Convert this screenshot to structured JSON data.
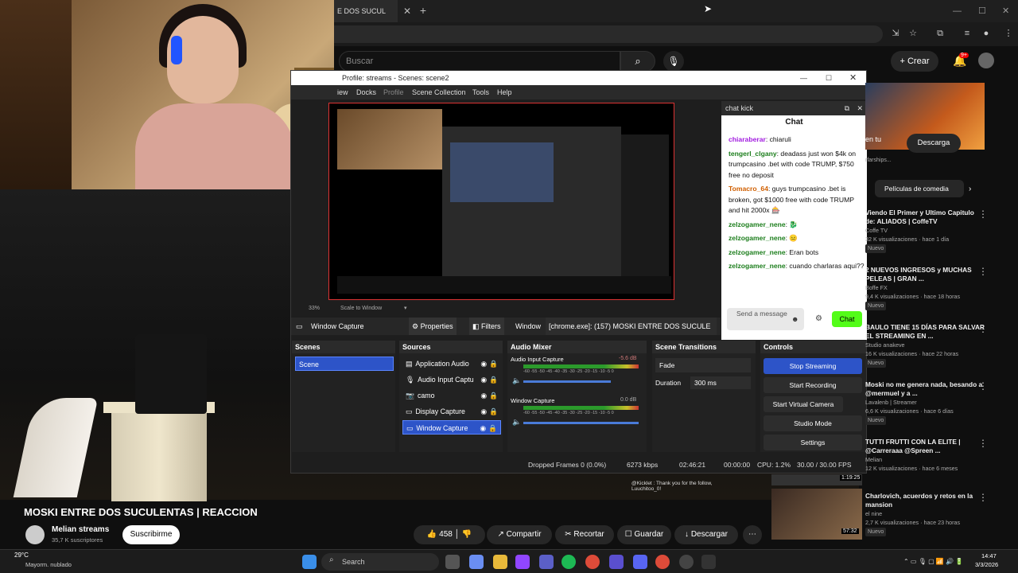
{
  "browser": {
    "tab_title": "E DOS SUCUL",
    "tab_close": "✕",
    "new_tab": "+",
    "win_min": "—",
    "win_max": "☐",
    "win_close": "✕"
  },
  "yt": {
    "search_placeholder": "Buscar",
    "create": "Crear",
    "notif_count": "9+",
    "video_title": "MOSKI ENTRE DOS SUCULENTAS | REACCION",
    "channel": "Melian streams",
    "subs": "35,7 K suscriptores",
    "subscribe": "Suscribirme",
    "likes": "458",
    "share": "Compartir",
    "clip": "Recortar",
    "save": "Guardar",
    "download": "Descargar"
  },
  "obs": {
    "window_title": "Profile: streams - Scenes: scene2",
    "menu": [
      "iew",
      "Docks",
      "Profile",
      "Scene Collection",
      "Tools",
      "Help"
    ],
    "zoom": "33%",
    "scale": "Scale to Window",
    "source_bar": {
      "name": "Window Capture",
      "properties": "Properties",
      "filters": "Filters",
      "window_label": "Window",
      "window_value": "[chrome.exe]: (157) MOSKI ENTRE DOS SUCULE"
    },
    "scenes": {
      "title": "Scenes",
      "items": [
        "Scene"
      ]
    },
    "sources": {
      "title": "Sources",
      "items": [
        "Application Audio",
        "Audio Input Captu",
        "camo",
        "Display Capture",
        "Window Capture"
      ]
    },
    "mixer": {
      "title": "Audio Mixer",
      "ch1": "Audio Input Capture",
      "ch1_db": "-5.6 dB",
      "ch2": "Window Capture",
      "ch2_db": "0.0 dB",
      "scale": "-60 -55 -50 -45 -40 -35 -30 -25 -20 -15 -10 -5 0"
    },
    "transitions": {
      "title": "Scene Transitions",
      "type": "Fade",
      "duration_label": "Duration",
      "duration": "300 ms"
    },
    "controls": {
      "title": "Controls",
      "stop_streaming": "Stop Streaming",
      "start_recording": "Start Recording",
      "virtual_cam": "Start Virtual Camera",
      "studio": "Studio Mode",
      "settings": "Settings"
    },
    "status": {
      "dropped": "Dropped Frames 0 (0.0%)",
      "kbps": "6273 kbps",
      "live": "02:46:21",
      "rec": "00:00:00",
      "cpu": "CPU: 1.2%",
      "fps": "30.00 / 30.00 FPS"
    }
  },
  "chat": {
    "header": "chat kick",
    "title": "Chat",
    "messages": [
      {
        "user": "chiaraberar",
        "text": ": chiaruli",
        "cls": "p"
      },
      {
        "user": "tengerl_clgany",
        "text": ": deadass just won $4k on trumpcasino .bet with code TRUMP, $750 free no deposit",
        "cls": ""
      },
      {
        "user": "Tomacro_64",
        "text": ": guys trumpcasino .bet is broken, got $1000 free with code TRUMP and hit 2000x 🎰",
        "cls": "o"
      },
      {
        "user": "zelzogamer_nene",
        "text": ": 🐉",
        "cls": ""
      },
      {
        "user": "zelzogamer_nene",
        "text": ": 😐",
        "cls": ""
      },
      {
        "user": "zelzogamer_nene",
        "text": ": Eran bots",
        "cls": ""
      },
      {
        "user": "zelzogamer_nene",
        "text": ": cuando charlaras aqui??",
        "cls": ""
      }
    ],
    "input_placeholder": "Send a message",
    "send": "Chat"
  },
  "side": {
    "top_snippet": "en tu",
    "top_meta": "rfarships...",
    "download": "Descarga",
    "chip": "Películas de comedia",
    "items": [
      {
        "title": "Viendo El Primer y Ultimo Capitulo de: ALIADOS | CoffeTV",
        "channel": "Coffe TV",
        "meta": "32 K visualizaciones · hace 1 día",
        "badge": "Nuevo"
      },
      {
        "title": "2 NUEVOS INGRESOS y MUCHAS PELEAS | GRAN ...",
        "channel": "Boffe FX",
        "meta": "9,4 K visualizaciones · hace 18 horas",
        "badge": "Nuevo"
      },
      {
        "title": "BAULO TIENE 15 DÍAS PARA SALVAR EL STREAMING EN ...",
        "channel": "Studio anakeve",
        "meta": "16 K visualizaciones · hace 22 horas",
        "badge": "Nuevo"
      },
      {
        "title": "Moski no me genera nada, besando a @mermuel y a ...",
        "channel": "Lavalenb | Streamer",
        "meta": "6,6 K visualizaciones · hace 6 días",
        "badge": "Nuevo"
      },
      {
        "title": "TUTTI FRUTTI CON LA ELITE | @Carreraaa @Spreen ...",
        "channel": "Melian",
        "meta": "12 K visualizaciones · hace 6 meses",
        "badge": ""
      },
      {
        "title": "Charlovich, acuerdos y retos en la mansion",
        "channel": "el nine",
        "meta": "2,7 K visualizaciones · hace 23 horas",
        "badge": "Nuevo"
      }
    ],
    "dur1": "1:19:25",
    "dur2": "57:32"
  },
  "video_chat": {
    "line": "@Kicklet : Thank you for the follow, Luuchitoo_0!"
  },
  "taskbar": {
    "weather_temp": "29°C",
    "weather_desc": "Mayorm. nublado",
    "search": "Search",
    "time": "14:47",
    "date": "3/3/2026"
  }
}
